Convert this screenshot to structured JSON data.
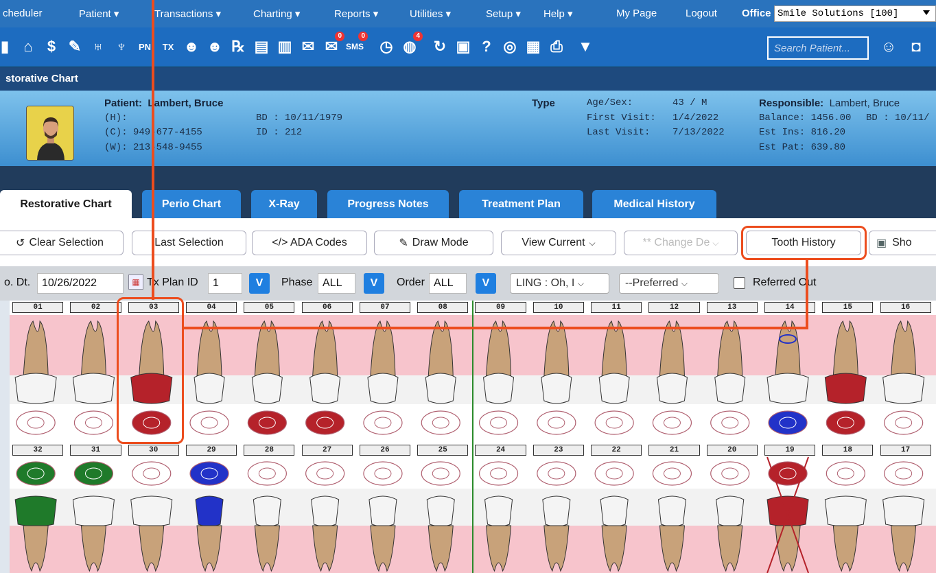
{
  "menu": {
    "items": [
      "cheduler",
      "Patient ▾",
      "Transactions ▾",
      "Charting ▾",
      "Reports ▾",
      "Utilities ▾",
      "Setup ▾",
      "Help ▾",
      "My Page",
      "Logout"
    ],
    "office_label": "Office",
    "office_value": "Smile Solutions [100]"
  },
  "toolbar_icons": {
    "badges": {
      "messages": "0",
      "sms": "0",
      "globe": "4"
    },
    "search_placeholder": "Search Patient..."
  },
  "page_title": "storative Chart",
  "patient": {
    "name_label": "Patient:",
    "name": "Lambert, Bruce",
    "home": "(H):",
    "cell": "(C): 949-677-4155",
    "work": "(W): 213-548-9455",
    "bd": "BD : 10/11/1979",
    "id": "ID : 212",
    "type_label": "Type",
    "age_sex_label": "Age/Sex:",
    "age_sex": "43 / M",
    "first_visit_label": "First Visit:",
    "first_visit": "1/4/2022",
    "last_visit_label": "Last Visit:",
    "last_visit": "7/13/2022",
    "responsible_label": "Responsible:",
    "responsible": "Lambert, Bruce",
    "balance": "Balance: 1456.00",
    "resp_bd": "BD : 10/11/",
    "est_ins": "Est Ins: 816.20",
    "est_pat": "Est Pat: 639.80"
  },
  "tabs": [
    "Restorative Chart",
    "Perio Chart",
    "X-Ray",
    "Progress Notes",
    "Treatment Plan",
    "Medical History"
  ],
  "actions": {
    "clear": "Clear Selection",
    "last": "Last Selection",
    "ada": "</> ADA Codes",
    "draw": "Draw Mode",
    "view": "View Current",
    "change": "** Change De",
    "history": "Tooth History",
    "show": "Sho"
  },
  "options": {
    "date_label": "o. Dt.",
    "date": "10/26/2022",
    "txplan_label": "Tx Plan ID",
    "txplan": "1",
    "phase_label": "Phase",
    "phase": "ALL",
    "order_label": "Order",
    "order": "ALL",
    "v": "V",
    "surface": "LING : Oh, I",
    "preferred": "--Preferred",
    "referred": "Referred Out"
  },
  "upper_teeth": [
    "01",
    "02",
    "03",
    "04",
    "05",
    "06",
    "07",
    "08",
    "09",
    "10",
    "11",
    "12",
    "13",
    "14",
    "15",
    "16"
  ],
  "lower_teeth": [
    "32",
    "31",
    "30",
    "29",
    "28",
    "27",
    "26",
    "25",
    "24",
    "23",
    "22",
    "21",
    "20",
    "19",
    "18",
    "17"
  ],
  "colors": {
    "accent": "#2a73bd",
    "tab": "#2a83d7",
    "highlight": "#ec4d1e",
    "gum": "#f7c4cc",
    "filling_red": "#b5222a",
    "filling_blue": "#2232c8",
    "filling_green": "#1f7a2a"
  }
}
